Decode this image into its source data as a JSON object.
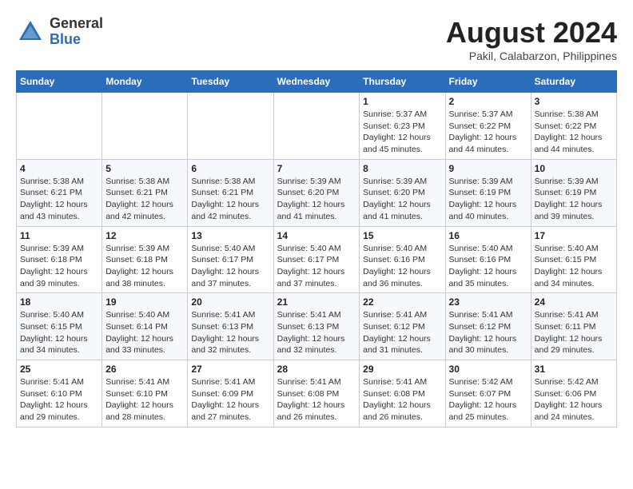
{
  "logo": {
    "general": "General",
    "blue": "Blue"
  },
  "title": "August 2024",
  "subtitle": "Pakil, Calabarzon, Philippines",
  "days_of_week": [
    "Sunday",
    "Monday",
    "Tuesday",
    "Wednesday",
    "Thursday",
    "Friday",
    "Saturday"
  ],
  "weeks": [
    [
      {
        "day": "",
        "info": ""
      },
      {
        "day": "",
        "info": ""
      },
      {
        "day": "",
        "info": ""
      },
      {
        "day": "",
        "info": ""
      },
      {
        "day": "1",
        "info": "Sunrise: 5:37 AM\nSunset: 6:23 PM\nDaylight: 12 hours\nand 45 minutes."
      },
      {
        "day": "2",
        "info": "Sunrise: 5:37 AM\nSunset: 6:22 PM\nDaylight: 12 hours\nand 44 minutes."
      },
      {
        "day": "3",
        "info": "Sunrise: 5:38 AM\nSunset: 6:22 PM\nDaylight: 12 hours\nand 44 minutes."
      }
    ],
    [
      {
        "day": "4",
        "info": "Sunrise: 5:38 AM\nSunset: 6:21 PM\nDaylight: 12 hours\nand 43 minutes."
      },
      {
        "day": "5",
        "info": "Sunrise: 5:38 AM\nSunset: 6:21 PM\nDaylight: 12 hours\nand 42 minutes."
      },
      {
        "day": "6",
        "info": "Sunrise: 5:38 AM\nSunset: 6:21 PM\nDaylight: 12 hours\nand 42 minutes."
      },
      {
        "day": "7",
        "info": "Sunrise: 5:39 AM\nSunset: 6:20 PM\nDaylight: 12 hours\nand 41 minutes."
      },
      {
        "day": "8",
        "info": "Sunrise: 5:39 AM\nSunset: 6:20 PM\nDaylight: 12 hours\nand 41 minutes."
      },
      {
        "day": "9",
        "info": "Sunrise: 5:39 AM\nSunset: 6:19 PM\nDaylight: 12 hours\nand 40 minutes."
      },
      {
        "day": "10",
        "info": "Sunrise: 5:39 AM\nSunset: 6:19 PM\nDaylight: 12 hours\nand 39 minutes."
      }
    ],
    [
      {
        "day": "11",
        "info": "Sunrise: 5:39 AM\nSunset: 6:18 PM\nDaylight: 12 hours\nand 39 minutes."
      },
      {
        "day": "12",
        "info": "Sunrise: 5:39 AM\nSunset: 6:18 PM\nDaylight: 12 hours\nand 38 minutes."
      },
      {
        "day": "13",
        "info": "Sunrise: 5:40 AM\nSunset: 6:17 PM\nDaylight: 12 hours\nand 37 minutes."
      },
      {
        "day": "14",
        "info": "Sunrise: 5:40 AM\nSunset: 6:17 PM\nDaylight: 12 hours\nand 37 minutes."
      },
      {
        "day": "15",
        "info": "Sunrise: 5:40 AM\nSunset: 6:16 PM\nDaylight: 12 hours\nand 36 minutes."
      },
      {
        "day": "16",
        "info": "Sunrise: 5:40 AM\nSunset: 6:16 PM\nDaylight: 12 hours\nand 35 minutes."
      },
      {
        "day": "17",
        "info": "Sunrise: 5:40 AM\nSunset: 6:15 PM\nDaylight: 12 hours\nand 34 minutes."
      }
    ],
    [
      {
        "day": "18",
        "info": "Sunrise: 5:40 AM\nSunset: 6:15 PM\nDaylight: 12 hours\nand 34 minutes."
      },
      {
        "day": "19",
        "info": "Sunrise: 5:40 AM\nSunset: 6:14 PM\nDaylight: 12 hours\nand 33 minutes."
      },
      {
        "day": "20",
        "info": "Sunrise: 5:41 AM\nSunset: 6:13 PM\nDaylight: 12 hours\nand 32 minutes."
      },
      {
        "day": "21",
        "info": "Sunrise: 5:41 AM\nSunset: 6:13 PM\nDaylight: 12 hours\nand 32 minutes."
      },
      {
        "day": "22",
        "info": "Sunrise: 5:41 AM\nSunset: 6:12 PM\nDaylight: 12 hours\nand 31 minutes."
      },
      {
        "day": "23",
        "info": "Sunrise: 5:41 AM\nSunset: 6:12 PM\nDaylight: 12 hours\nand 30 minutes."
      },
      {
        "day": "24",
        "info": "Sunrise: 5:41 AM\nSunset: 6:11 PM\nDaylight: 12 hours\nand 29 minutes."
      }
    ],
    [
      {
        "day": "25",
        "info": "Sunrise: 5:41 AM\nSunset: 6:10 PM\nDaylight: 12 hours\nand 29 minutes."
      },
      {
        "day": "26",
        "info": "Sunrise: 5:41 AM\nSunset: 6:10 PM\nDaylight: 12 hours\nand 28 minutes."
      },
      {
        "day": "27",
        "info": "Sunrise: 5:41 AM\nSunset: 6:09 PM\nDaylight: 12 hours\nand 27 minutes."
      },
      {
        "day": "28",
        "info": "Sunrise: 5:41 AM\nSunset: 6:08 PM\nDaylight: 12 hours\nand 26 minutes."
      },
      {
        "day": "29",
        "info": "Sunrise: 5:41 AM\nSunset: 6:08 PM\nDaylight: 12 hours\nand 26 minutes."
      },
      {
        "day": "30",
        "info": "Sunrise: 5:42 AM\nSunset: 6:07 PM\nDaylight: 12 hours\nand 25 minutes."
      },
      {
        "day": "31",
        "info": "Sunrise: 5:42 AM\nSunset: 6:06 PM\nDaylight: 12 hours\nand 24 minutes."
      }
    ]
  ]
}
